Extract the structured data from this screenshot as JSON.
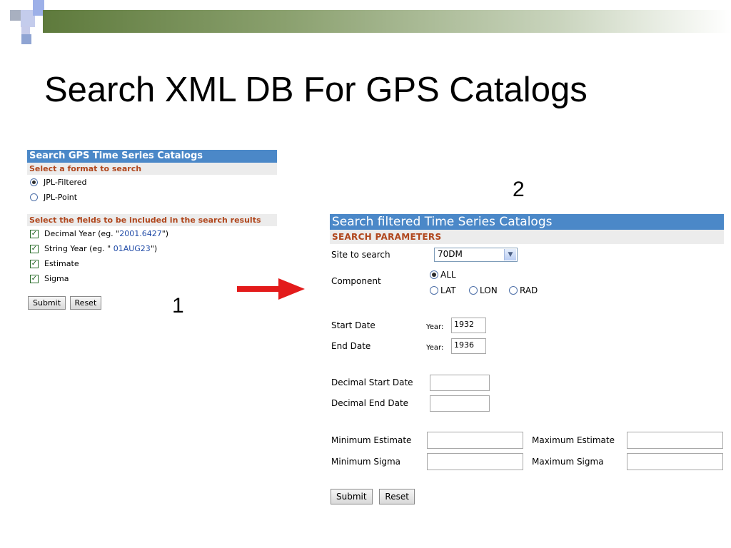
{
  "slide": {
    "title": "Search XML DB For GPS Catalogs",
    "marker_1": "1",
    "marker_2": "2",
    "colors": {
      "accent_green": "#5e7a3c",
      "accent_blue": "#4b88c8",
      "header_orange": "#b0461c",
      "arrow_red": "#e31b1b"
    }
  },
  "panel1": {
    "title": "Search GPS Time Series Catalogs",
    "format_heading": "Select a format to search",
    "formats": [
      {
        "label": "JPL-Filtered",
        "selected": true
      },
      {
        "label": "JPL-Point",
        "selected": false
      }
    ],
    "fields_heading": "Select the fields to be included in the search results",
    "fields": [
      {
        "prefix": "Decimal Year (eg. \"",
        "example": "2001.6427",
        "suffix": "\")",
        "checked": true
      },
      {
        "prefix": "String Year (eg. \" ",
        "example": "01AUG23",
        "suffix": "\")",
        "checked": true
      },
      {
        "prefix": "Estimate",
        "example": "",
        "suffix": "",
        "checked": true
      },
      {
        "prefix": "Sigma",
        "example": "",
        "suffix": "",
        "checked": true
      }
    ],
    "submit_label": "Submit",
    "reset_label": "Reset"
  },
  "panel2": {
    "title": "Search filtered Time Series Catalogs",
    "params_heading": "SEARCH PARAMETERS",
    "site_label": "Site to search",
    "site_value": "70DM",
    "component_label": "Component",
    "components": [
      {
        "label": "ALL",
        "selected": true
      },
      {
        "label": "LAT",
        "selected": false
      },
      {
        "label": "LON",
        "selected": false
      },
      {
        "label": "RAD",
        "selected": false
      }
    ],
    "start_date_label": "Start Date",
    "end_date_label": "End Date",
    "year_prefix": "Year:",
    "start_year": "1932",
    "end_year": "1936",
    "decimal_start_label": "Decimal Start Date",
    "decimal_end_label": "Decimal End Date",
    "decimal_start_value": "",
    "decimal_end_value": "",
    "min_estimate_label": "Minimum Estimate",
    "max_estimate_label": "Maximum Estimate",
    "min_sigma_label": "Minimum Sigma",
    "max_sigma_label": "Maximum Sigma",
    "submit_label": "Submit",
    "reset_label": "Reset"
  }
}
